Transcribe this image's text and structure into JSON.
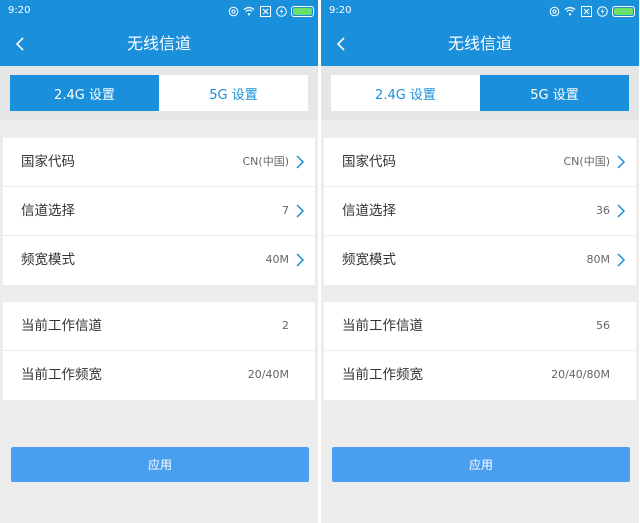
{
  "screens": [
    {
      "status": {
        "time": "9:20",
        "icons": [
          "alarm-icon",
          "wifi-icon",
          "notification-x-icon",
          "flash-icon",
          "battery-icon"
        ]
      },
      "header": {
        "back_icon": "chevron-left-icon",
        "title": "无线信道"
      },
      "tabs": [
        {
          "label": "2.4G 设置",
          "active": true
        },
        {
          "label": "5G 设置",
          "active": false
        }
      ],
      "settings": [
        {
          "label": "国家代码",
          "value": "CN(中国)"
        },
        {
          "label": "信道选择",
          "value": "7"
        },
        {
          "label": "频宽模式",
          "value": "40M"
        }
      ],
      "status_info": [
        {
          "label": "当前工作信道",
          "value": "2"
        },
        {
          "label": "当前工作频宽",
          "value": "20/40M"
        }
      ],
      "apply_label": "应用"
    },
    {
      "status": {
        "time": "9:20",
        "icons": [
          "alarm-icon",
          "wifi-icon",
          "notification-x-icon",
          "flash-icon",
          "battery-icon"
        ]
      },
      "header": {
        "back_icon": "chevron-left-icon",
        "title": "无线信道"
      },
      "tabs": [
        {
          "label": "2.4G 设置",
          "active": false
        },
        {
          "label": "5G 设置",
          "active": true
        }
      ],
      "settings": [
        {
          "label": "国家代码",
          "value": "CN(中国)"
        },
        {
          "label": "信道选择",
          "value": "36"
        },
        {
          "label": "频宽模式",
          "value": "80M"
        }
      ],
      "status_info": [
        {
          "label": "当前工作信道",
          "value": "56"
        },
        {
          "label": "当前工作频宽",
          "value": "20/40/80M"
        }
      ],
      "apply_label": "应用"
    }
  ],
  "colors": {
    "primary": "#1a8fdb",
    "button": "#4a9ef0",
    "background": "#ececec",
    "battery": "#6ae06a"
  }
}
